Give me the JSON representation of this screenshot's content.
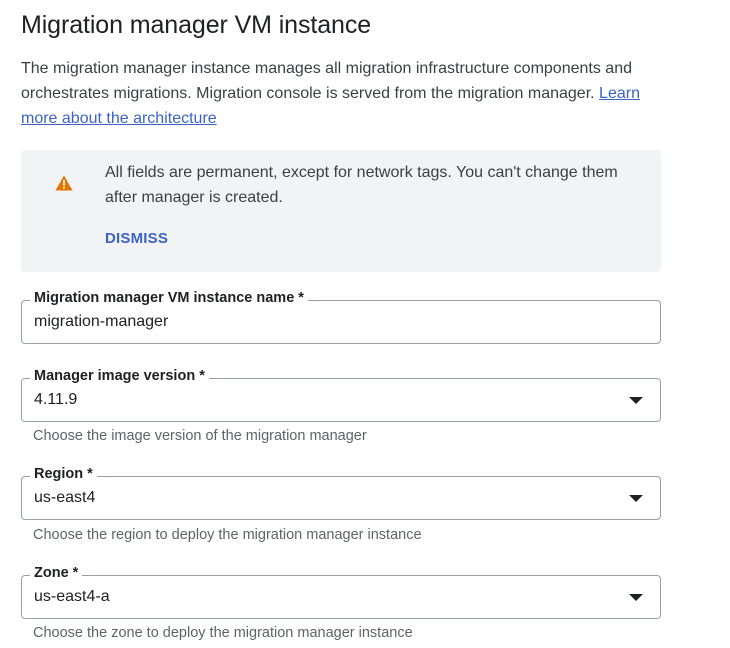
{
  "header": {
    "title": "Migration manager VM instance",
    "description": "The migration manager instance manages all migration infrastructure components and orchestrates migrations. Migration console is served from the migration manager.",
    "learn_more_link": "Learn more about the architecture"
  },
  "banner": {
    "icon": "warning-icon",
    "message": "All fields are permanent, except for network tags. You can't change them after manager is created.",
    "dismiss_label": "DISMISS",
    "accent_color": "#e37400"
  },
  "fields": {
    "instance_name": {
      "label": "Migration manager VM instance name *",
      "value": "migration-manager"
    },
    "image_version": {
      "label": "Manager image version *",
      "value": "4.11.9",
      "hint": "Choose the image version of the migration manager"
    },
    "region": {
      "label": "Region *",
      "value": "us-east4",
      "hint": "Choose the region to deploy the migration manager instance"
    },
    "zone": {
      "label": "Zone *",
      "value": "us-east4-a",
      "hint": "Choose the zone to deploy the migration manager instance"
    }
  },
  "colors": {
    "link": "#3c63c7",
    "banner_bg": "#f1f3f4",
    "border": "#9aa0a6"
  }
}
